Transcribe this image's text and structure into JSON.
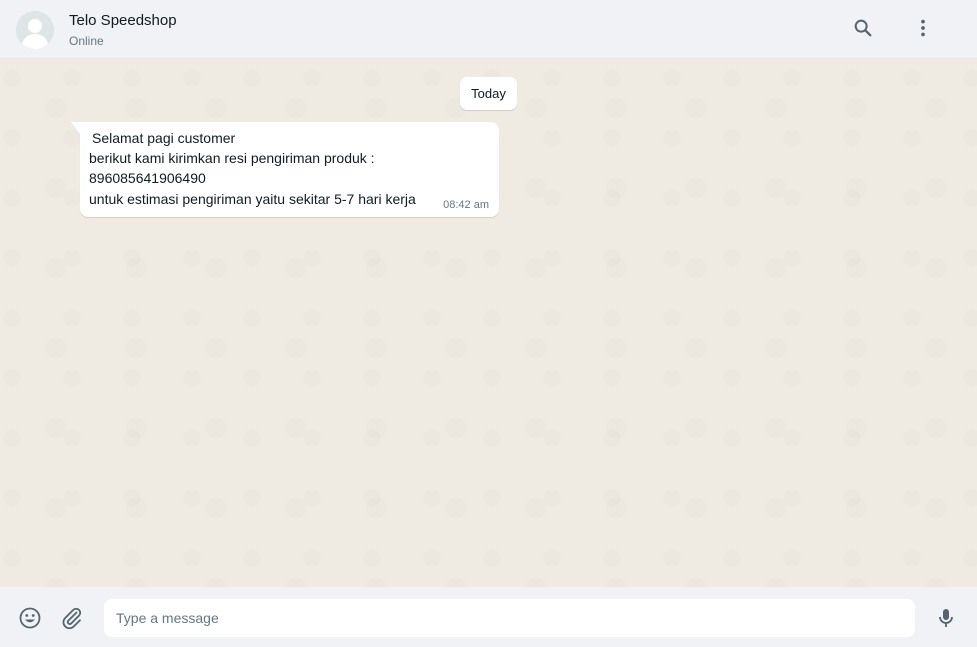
{
  "header": {
    "contact_name": "Telo Speedshop",
    "contact_status": "Online",
    "icons": [
      "avatar-default",
      "search-icon",
      "more-vertical-icon"
    ]
  },
  "chat": {
    "date_separator": "Today",
    "messages": [
      {
        "direction": "incoming",
        "lines": [
          "Selamat pagi customer",
          "berikut kami kirimkan resi pengiriman produk :",
          "896085641906490",
          "untuk estimasi pengiriman yaitu sekitar 5-7 hari kerja"
        ],
        "time": "08:42 am"
      }
    ]
  },
  "footer": {
    "placeholder": "Type a message",
    "icons": [
      "emoji-icon",
      "attach-icon",
      "mic-icon"
    ]
  },
  "colors": {
    "header_bg": "#f0f2f5",
    "chat_bg": "#efeae2",
    "bubble_bg": "#ffffff",
    "icon_color": "#54656f"
  }
}
